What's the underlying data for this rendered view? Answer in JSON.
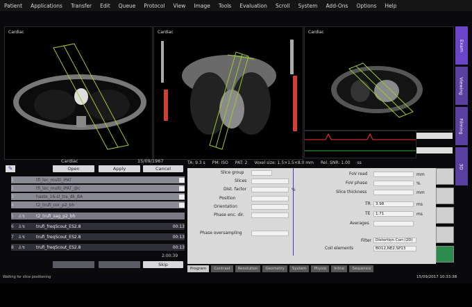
{
  "menu": [
    "Patient",
    "Applications",
    "Transfer",
    "Edit",
    "Queue",
    "Protocol",
    "View",
    "Image",
    "Tools",
    "Evaluation",
    "Scroll",
    "System",
    "Add-Ons",
    "Options",
    "Help"
  ],
  "viewports": [
    {
      "label": "Cardiac"
    },
    {
      "label": "Cardiac"
    },
    {
      "label": "Cardiac"
    }
  ],
  "side_tabs": [
    "Exam",
    "Viewing",
    "Filming",
    "3D"
  ],
  "info": {
    "ta": "TA: 9.3 s",
    "pm": "PM: ISO",
    "pat": "PAT: 2",
    "voxel": "Voxel size: 1.5×1.5×8.0 mm",
    "rel_snr": "Rel. SNR: 1.00",
    "mode": "ss"
  },
  "queue": {
    "title": "Cardiac",
    "id": "15/09/1967",
    "open": "Open",
    "apply": "Apply",
    "cancel": "Cancel",
    "rows": [
      {
        "num": "1",
        "name": "tfi_loc_multi_iPAT",
        "time": "",
        "state": "done"
      },
      {
        "num": "2",
        "name": "tfi_loc_multi_iPAT_@c",
        "time": "",
        "state": "done"
      },
      {
        "num": "3",
        "name": "haste_16-sl_tra_dk_BA",
        "time": "",
        "state": "done"
      },
      {
        "num": "4",
        "name": "t2_trufi_cor_p2_bh",
        "time": "",
        "state": "done"
      },
      {
        "num": "5",
        "name": "t2_trufi_sag_p2_bh",
        "time": "",
        "state": "sel"
      },
      {
        "num": "6",
        "name": "trufi_freqScout_ES2.8",
        "time": "00:13",
        "state": "wait"
      },
      {
        "num": "7",
        "name": "trufi_freqScout_ES2.8",
        "time": "00:13",
        "state": "wait"
      },
      {
        "num": "8",
        "name": "trufi_freqScout_ES2.8",
        "time": "00:13",
        "state": "wait"
      }
    ],
    "total": "2:00:39",
    "skip": "Skip"
  },
  "params": {
    "slice_group": "Slice group",
    "slices": "Slices",
    "dist_factor": "Dist. factor",
    "position": "Position",
    "orientation": "Orientation",
    "phase_enc": "Phase enc. dir.",
    "phase_oversampling": "Phase oversampling",
    "fov_read": "FoV read",
    "fov_phase": "FoV phase",
    "slice_thickness": "Slice thickness",
    "tr": "TR",
    "te": "TE",
    "averages": "Averages",
    "filter": "Filter",
    "coil_elements": "Coil elements",
    "tr_val": "3.98",
    "te_val": "1.71",
    "filter_val": "Distortion Corr.(2D)",
    "coil_val": "BO12,NE2,SP13",
    "unit_mm": "mm",
    "unit_ms": "ms",
    "unit_pct": "%"
  },
  "tabs": [
    "Program",
    "Contrast",
    "Resolution",
    "Geometry",
    "System",
    "Physio",
    "Inline",
    "Sequence"
  ],
  "status": "Waiting for slice positioning",
  "clock": "15/09/2017 10:33:38"
}
